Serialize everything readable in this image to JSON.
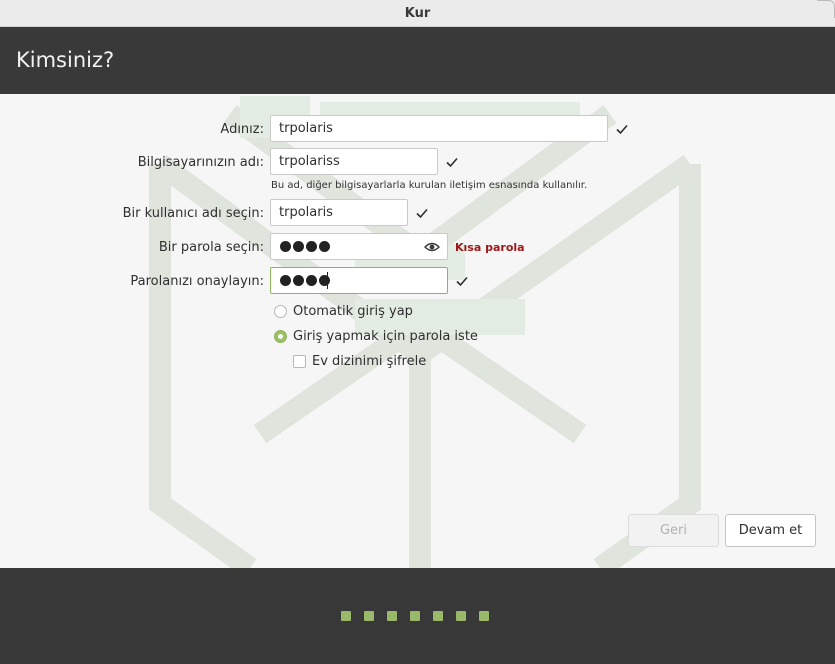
{
  "window": {
    "title": "Kur"
  },
  "header": {
    "title": "Kimsiniz?"
  },
  "form": {
    "name_label": "Adınız:",
    "name_value": "trpolaris",
    "computer_label": "Bilgisayarınızın adı:",
    "computer_value": "trpolariss",
    "computer_hint": "Bu ad, diğer bilgisayarlarla kurulan iletişim esnasında kullanılır.",
    "username_label": "Bir kullanıcı adı seçin:",
    "username_value": "trpolaris",
    "password_label": "Bir parola seçin:",
    "password_strength": "Kısa parola",
    "confirm_label": "Parolanızı onaylayın:"
  },
  "options": {
    "auto_login": "Otomatik giriş yap",
    "require_password": "Giriş yapmak için parola iste",
    "encrypt_home": "Ev dizinimi şifrele",
    "selected": "require_password",
    "encrypt_home_checked": false
  },
  "buttons": {
    "back": "Geri",
    "next": "Devam et"
  },
  "progress": {
    "total_steps": 7
  },
  "colors": {
    "accent": "#9ac05f",
    "header": "#393939",
    "warning": "#a01818"
  }
}
